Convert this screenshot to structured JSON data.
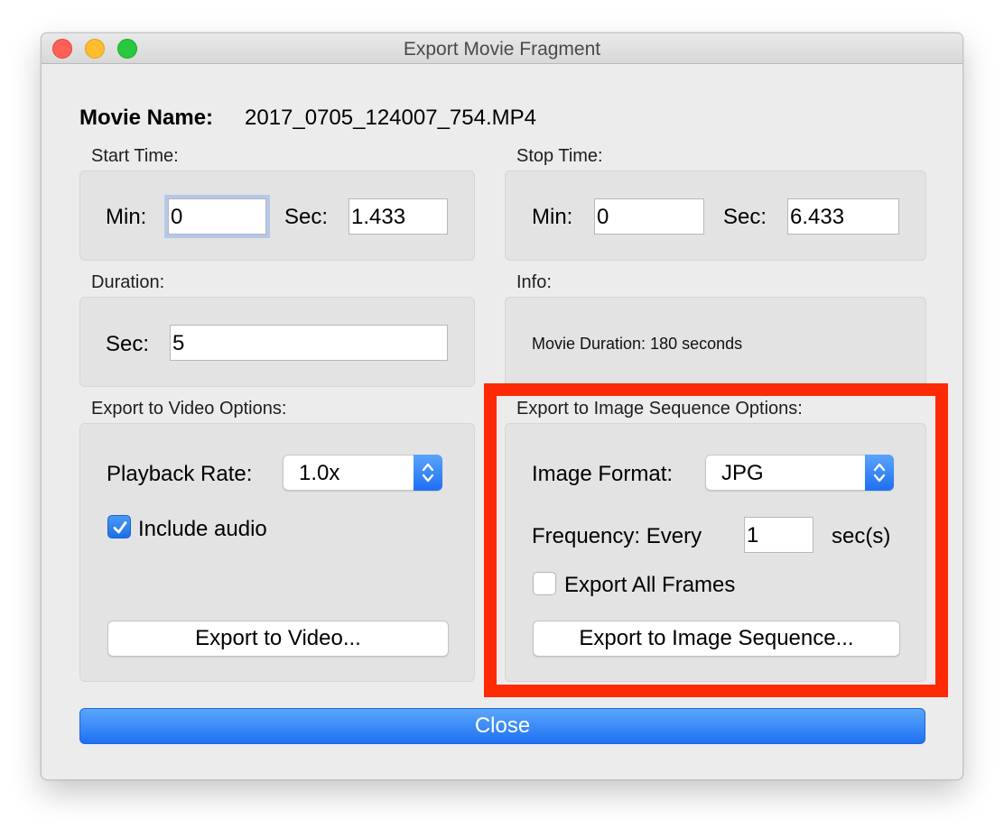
{
  "window": {
    "title": "Export Movie Fragment"
  },
  "movie": {
    "label": "Movie Name:",
    "value": "2017_0705_124007_754.MP4"
  },
  "start_time": {
    "label": "Start Time:",
    "min_label": "Min:",
    "min_value": "0",
    "sec_label": "Sec:",
    "sec_value": "1.433"
  },
  "stop_time": {
    "label": "Stop Time:",
    "min_label": "Min:",
    "min_value": "0",
    "sec_label": "Sec:",
    "sec_value": "6.433"
  },
  "duration": {
    "label": "Duration:",
    "sec_label": "Sec:",
    "sec_value": "5"
  },
  "info": {
    "label": "Info:",
    "text": "Movie Duration: 180 seconds"
  },
  "video_options": {
    "label": "Export to Video Options:",
    "playback_label": "Playback Rate:",
    "playback_value": "1.0x",
    "include_audio_label": "Include audio",
    "include_audio_checked": true,
    "export_button": "Export to Video..."
  },
  "image_options": {
    "label": "Export to Image Sequence Options:",
    "format_label": "Image Format:",
    "format_value": "JPG",
    "frequency_label": "Frequency: Every",
    "frequency_value": "1",
    "frequency_unit": "sec(s)",
    "export_all_label": "Export All Frames",
    "export_all_checked": false,
    "export_button": "Export to Image Sequence..."
  },
  "close_button": "Close",
  "colors": {
    "accent": "#1f71f2",
    "highlight": "#fd2a05",
    "window_bg": "#ececec",
    "group_bg": "#e3e3e3"
  }
}
